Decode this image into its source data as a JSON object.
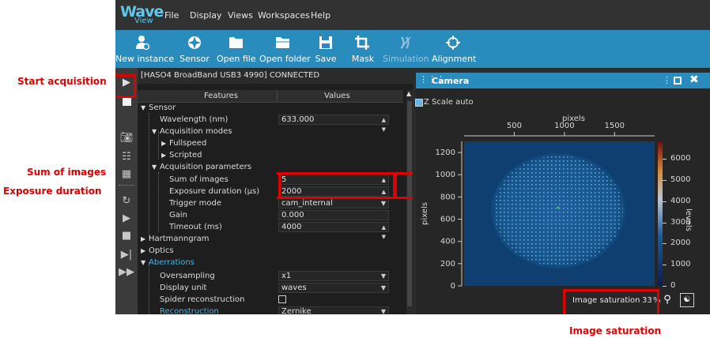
{
  "app": {
    "logo": {
      "top": "Wave",
      "bottom": "View"
    },
    "menu": [
      "File",
      "Display",
      "Views",
      "Workspaces",
      "Help"
    ],
    "toolbar": [
      {
        "label": "New instance",
        "icon": "new-instance-icon"
      },
      {
        "label": "Sensor",
        "icon": "sensor-icon"
      },
      {
        "label": "Open file",
        "icon": "folder-icon"
      },
      {
        "label": "Open folder",
        "icon": "folder-open-icon"
      },
      {
        "label": "Save",
        "icon": "save-icon"
      },
      {
        "label": "Mask",
        "icon": "crop-icon"
      },
      {
        "label": "Simulation",
        "icon": "simulation-icon",
        "disabled": true
      },
      {
        "label": "Alignment",
        "icon": "crosshair-icon"
      }
    ],
    "status": "[HASO4 BroadBand USB3 4990] CONNECTED",
    "tree": {
      "headers": {
        "features": "Features",
        "values": "Values"
      },
      "rows": [
        {
          "label": "Sensor"
        },
        {
          "label": "Wavelength (nm)",
          "value": "633.000"
        },
        {
          "label": "Acquisition modes"
        },
        {
          "label": "Fullspeed"
        },
        {
          "label": "Scripted"
        },
        {
          "label": "Acquisition parameters"
        },
        {
          "label": "Sum of images",
          "value": "5"
        },
        {
          "label": "Exposure duration (µs)",
          "value": "2000"
        },
        {
          "label": "Trigger mode",
          "value": "cam_internal"
        },
        {
          "label": "Gain",
          "value": "0.000"
        },
        {
          "label": "Timeout (ms)",
          "value": "4000"
        },
        {
          "label": "Hartmanngram"
        },
        {
          "label": "Optics"
        },
        {
          "label": "Aberrations"
        },
        {
          "label": "Oversampling",
          "value": "x1"
        },
        {
          "label": "Display unit",
          "value": "waves"
        },
        {
          "label": "Spider reconstruction"
        },
        {
          "label": "Reconstruction",
          "value": "Zernike"
        }
      ]
    },
    "camera": {
      "title": "Camera",
      "z_scale": "Z Scale auto",
      "saturation_label": "Image saturation",
      "saturation_value": "33",
      "saturation_unit": "%",
      "x_axis": {
        "label": "pixels",
        "ticks": [
          "500",
          "1000",
          "1500"
        ]
      },
      "y_axis": {
        "label": "pixels",
        "ticks": [
          "1200",
          "1000",
          "800",
          "600",
          "400",
          "200",
          "0"
        ]
      },
      "colorbar": {
        "label": "levels",
        "ticks": [
          "6000",
          "5000",
          "4000",
          "3000",
          "2000",
          "1000",
          "0"
        ]
      }
    }
  },
  "annotations": {
    "start_acquisition": "Start acquisition",
    "sum_of_images": "Sum of images",
    "exposure_duration": "Exposure duration",
    "image_saturation": "Image saturation"
  },
  "colors": {
    "accent": "#2a8bbd",
    "highlight": "#e00000"
  }
}
